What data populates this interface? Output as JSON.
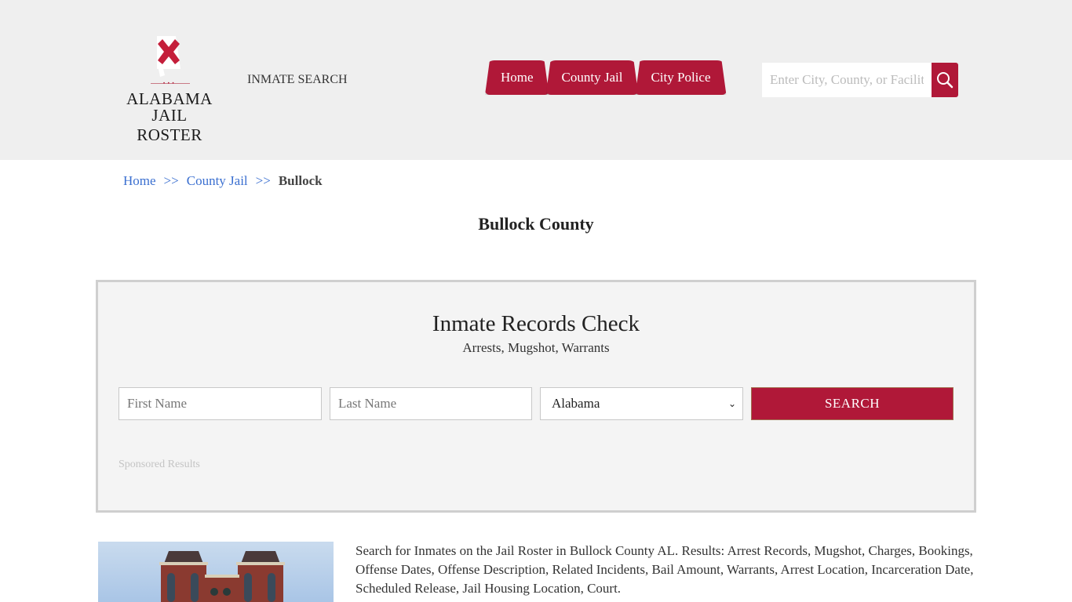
{
  "header": {
    "logo": {
      "line1": "ALABAMA",
      "line2": "JAIL ROSTER",
      "dots": "• • •"
    },
    "inmate_search_link": "INMATE SEARCH",
    "nav": [
      {
        "label": "Home"
      },
      {
        "label": "County Jail"
      },
      {
        "label": "City Police"
      }
    ],
    "search": {
      "placeholder": "Enter City, County, or Facility",
      "icon": "search-icon"
    },
    "colors": {
      "brand": "#b01838",
      "header_bg": "#efefef"
    }
  },
  "breadcrumb": {
    "items": [
      {
        "label": "Home"
      },
      {
        "label": "County Jail"
      }
    ],
    "separator": ">>",
    "current": "Bullock"
  },
  "page_title": "Bullock County",
  "records_check": {
    "title": "Inmate Records Check",
    "subtitle": "Arrests, Mugshot, Warrants",
    "first_name_placeholder": "First Name",
    "last_name_placeholder": "Last Name",
    "state_selected": "Alabama",
    "search_label": "SEARCH",
    "sponsored": "Sponsored Results"
  },
  "content": {
    "photo_alt": "Bullock County Courthouse",
    "description": "Search for Inmates on the Jail Roster in Bullock  County AL. Results: Arrest Records, Mugshot, Charges, Bookings, Offense Dates, Offense Description, Related Incidents, Bail Amount, Warrants, Arrest Location, Incarceration Date, Scheduled Release, Jail Housing Location, Court."
  }
}
